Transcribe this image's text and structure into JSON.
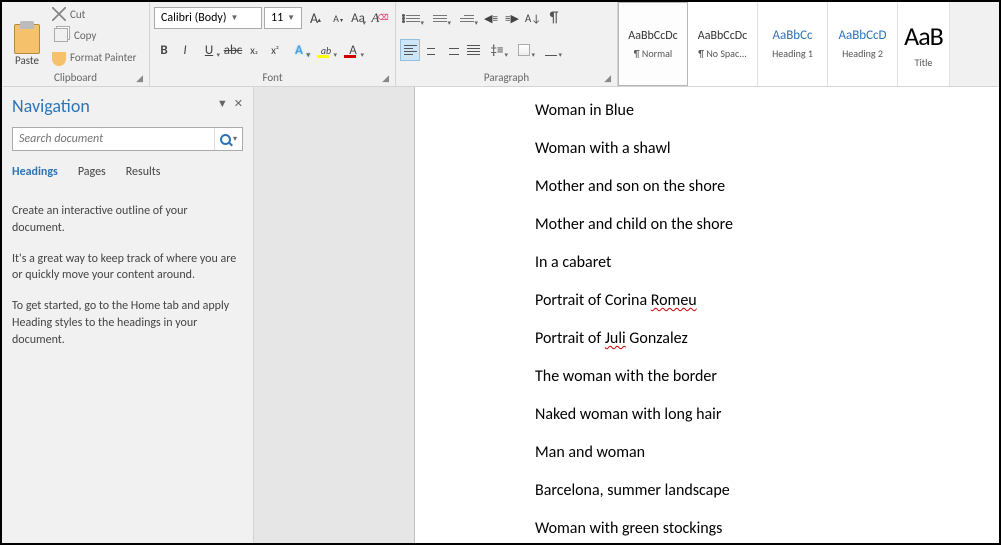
{
  "ribbon": {
    "clipboard": {
      "label": "Clipboard",
      "paste": "Paste",
      "cut": "Cut",
      "copy": "Copy",
      "format_painter": "Format Painter"
    },
    "font": {
      "label": "Font",
      "name": "Calibri (Body)",
      "size": "11",
      "grow": "A",
      "shrink": "A",
      "case": "Aa",
      "bold": "B",
      "italic": "I",
      "underline": "U",
      "strike": "abc",
      "sub": "x",
      "sup": "x",
      "effects": "A",
      "highlight": "ab",
      "color": "A"
    },
    "paragraph": {
      "label": "Paragraph",
      "sort": "A↓",
      "pilcrow": "¶",
      "spacing": "‡≡"
    },
    "styles": [
      {
        "preview": "AaBbCcDc",
        "label": "¶ Normal",
        "class": ""
      },
      {
        "preview": "AaBbCcDc",
        "label": "¶ No Spac...",
        "class": ""
      },
      {
        "preview": "AaBbCc",
        "label": "Heading 1",
        "class": "blue"
      },
      {
        "preview": "AaBbCcD",
        "label": "Heading 2",
        "class": "blue"
      },
      {
        "preview": "AaB",
        "label": "Title",
        "class": "big"
      }
    ]
  },
  "nav": {
    "title": "Navigation",
    "search_placeholder": "Search document",
    "tabs": [
      "Headings",
      "Pages",
      "Results"
    ],
    "help": [
      "Create an interactive outline of your document.",
      "It's a great way to keep track of where you are or quickly move your content around.",
      "To get started, go to the Home tab and apply Heading styles to the headings in your document."
    ]
  },
  "document": {
    "lines": [
      {
        "t": "Woman in Blue"
      },
      {
        "t": "Woman with a shawl"
      },
      {
        "t": "Mother and son on the shore"
      },
      {
        "t": "Mother and child on the shore"
      },
      {
        "t": "In a cabaret"
      },
      {
        "pre": "Portrait of Corina ",
        "sq": "Romeu"
      },
      {
        "pre": "Portrait of ",
        "sq": "Juli",
        "post": " Gonzalez"
      },
      {
        "t": "The woman with the border"
      },
      {
        "t": "Naked woman with long hair"
      },
      {
        "t": "Man and woman"
      },
      {
        "t": "Barcelona, summer landscape"
      },
      {
        "t": "Woman with green stockings"
      }
    ]
  }
}
